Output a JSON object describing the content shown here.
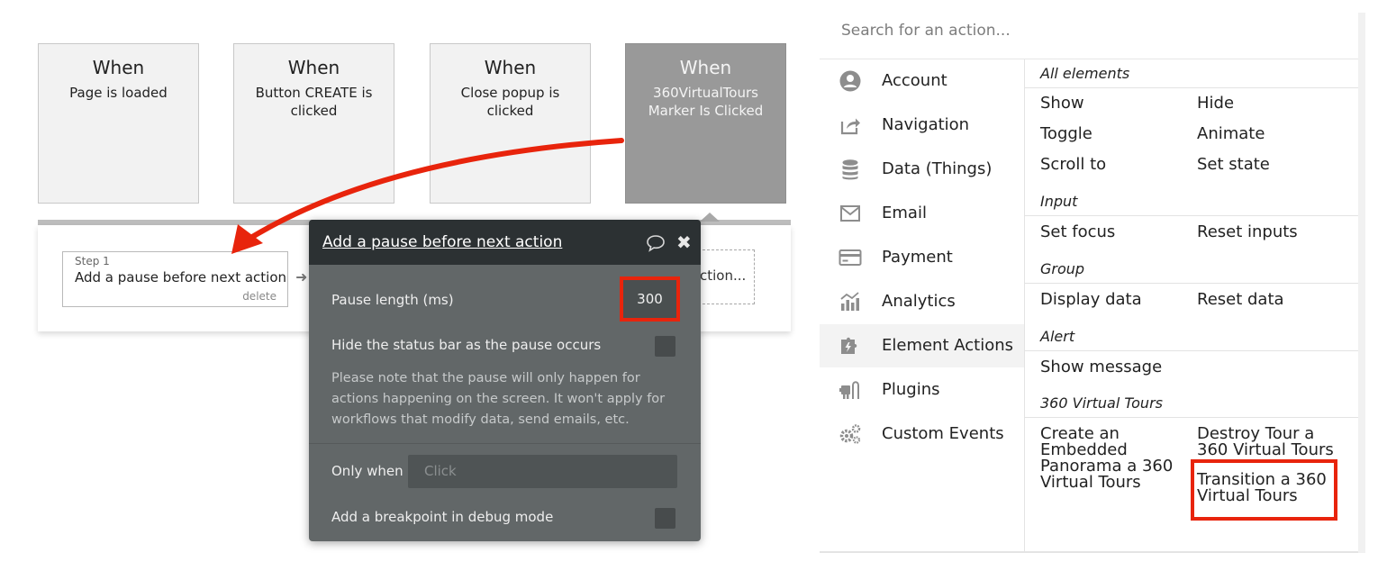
{
  "workflow": {
    "events": [
      {
        "when": "When",
        "description": "Page is loaded"
      },
      {
        "when": "When",
        "description": "Button CREATE is clicked"
      },
      {
        "when": "When",
        "description": "Close popup is clicked"
      },
      {
        "when": "When",
        "description": "360VirtualTours Marker Is Clicked"
      }
    ],
    "step": {
      "number": "Step 1",
      "title": "Add a pause before next action",
      "delete_label": "delete"
    },
    "add_action_label": "ction..."
  },
  "popup": {
    "title": "Add a pause before next action",
    "pause_label": "Pause length (ms)",
    "pause_value": "300",
    "hide_status_label": "Hide the status bar as the pause occurs",
    "note": "Please note that the pause will only happen for actions happening on the screen. It won't apply for workflows that modify data, send emails, etc.",
    "only_when_label": "Only when",
    "only_when_placeholder": "Click",
    "breakpoint_label": "Add a breakpoint in debug mode"
  },
  "action_search": {
    "placeholder": "Search for an action..."
  },
  "categories": [
    {
      "label": "Account",
      "icon": "user-circle-icon"
    },
    {
      "label": "Navigation",
      "icon": "share-icon"
    },
    {
      "label": "Data (Things)",
      "icon": "database-icon"
    },
    {
      "label": "Email",
      "icon": "envelope-icon"
    },
    {
      "label": "Payment",
      "icon": "credit-card-icon"
    },
    {
      "label": "Analytics",
      "icon": "bar-chart-icon"
    },
    {
      "label": "Element Actions",
      "icon": "puzzle-icon",
      "selected": true
    },
    {
      "label": "Plugins",
      "icon": "plug-icon"
    },
    {
      "label": "Custom Events",
      "icon": "gears-icon"
    }
  ],
  "sections": {
    "all_elements": {
      "heading": "All elements",
      "actions": [
        "Show",
        "Hide",
        "Toggle",
        "Animate",
        "Scroll to",
        "Set state"
      ]
    },
    "input": {
      "heading": "Input",
      "actions": [
        "Set focus",
        "Reset inputs"
      ]
    },
    "group": {
      "heading": "Group",
      "actions": [
        "Display data",
        "Reset data"
      ]
    },
    "alert": {
      "heading": "Alert",
      "actions": [
        "Show message"
      ]
    },
    "virtual_tours": {
      "heading": "360 Virtual Tours",
      "actions": [
        "Create an Embedded Panorama a 360 Virtual Tours",
        "Destroy Tour a 360 Virtual Tours",
        "Transition a 360 Virtual Tours"
      ]
    }
  },
  "colors": {
    "highlight": "#e8240c",
    "popup_bg": "#626768",
    "popup_header": "#2c3133",
    "active_event": "#999999"
  }
}
